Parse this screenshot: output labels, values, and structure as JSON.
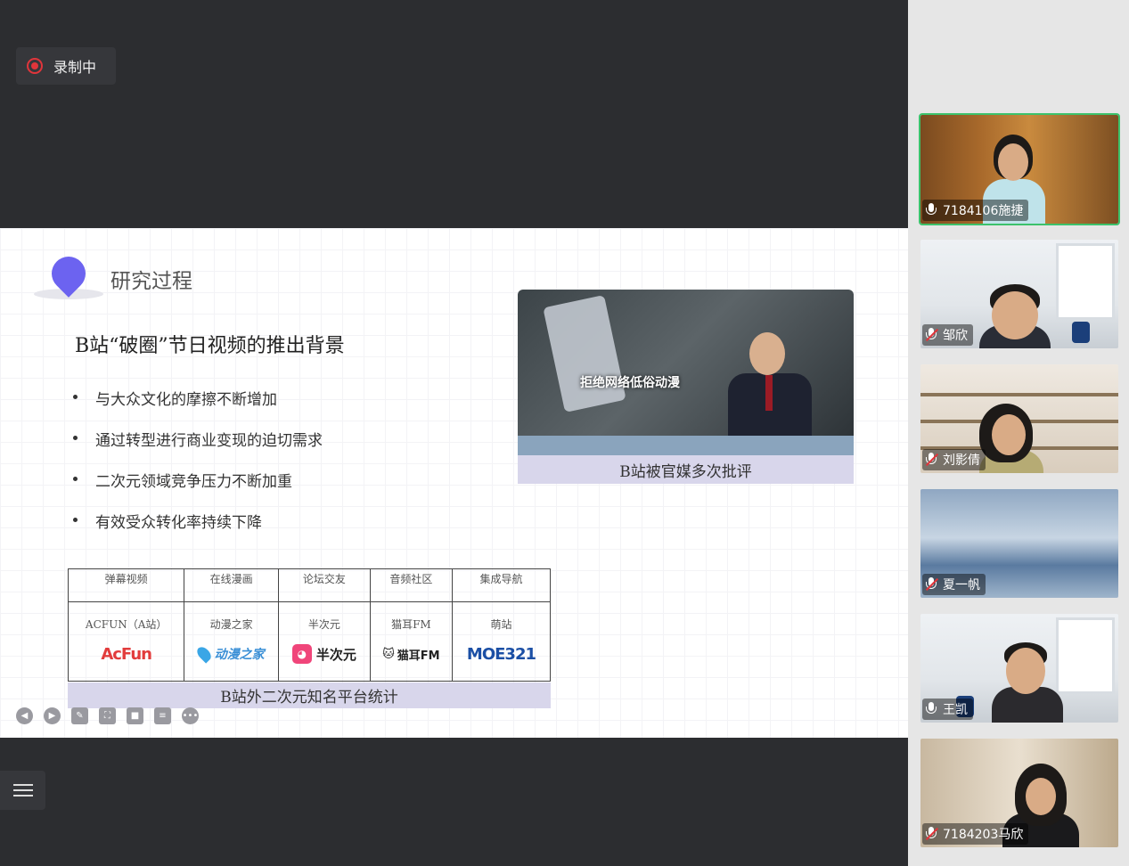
{
  "recording": {
    "label": "录制中"
  },
  "slide": {
    "section_title": "研究过程",
    "heading": "B站“破圈”节日视频的推出背景",
    "bullets": [
      "与大众文化的摩擦不断增加",
      "通过转型进行商业变现的迫切需求",
      "二次元领域竞争压力不断加重",
      "有效受众转化率持续下降"
    ],
    "news_image": {
      "overlay_text": "拒绝网络低俗动漫",
      "caption": "B站被官媒多次批评"
    },
    "platform_table": {
      "headers": [
        "弹幕视频",
        "在线漫画",
        "论坛交友",
        "音频社区",
        "集成导航"
      ],
      "rows": [
        {
          "name": "ACFUN（A站）",
          "logo": "AcFun"
        },
        {
          "name": "动漫之家",
          "logo": "动漫之家"
        },
        {
          "name": "半次元",
          "logo": "半次元"
        },
        {
          "name": "猫耳FM",
          "logo": "猫耳FM"
        },
        {
          "name": "萌站",
          "logo": "MOE321"
        }
      ],
      "caption": "B站外二次元知名平台统计"
    },
    "toolbar_icons": [
      "prev-icon",
      "next-icon",
      "pen-icon",
      "screenshot-icon",
      "camera-icon",
      "comment-icon",
      "more-icon"
    ]
  },
  "participants": [
    {
      "name": "7184106施捷",
      "muted": false,
      "active": true
    },
    {
      "name": "邹欣",
      "muted": true,
      "active": false
    },
    {
      "name": "刘影倩",
      "muted": true,
      "active": false
    },
    {
      "name": "夏一帆",
      "muted": true,
      "active": false
    },
    {
      "name": "王凯",
      "muted": false,
      "active": false
    },
    {
      "name": "7184203马欣",
      "muted": true,
      "active": false
    }
  ]
}
